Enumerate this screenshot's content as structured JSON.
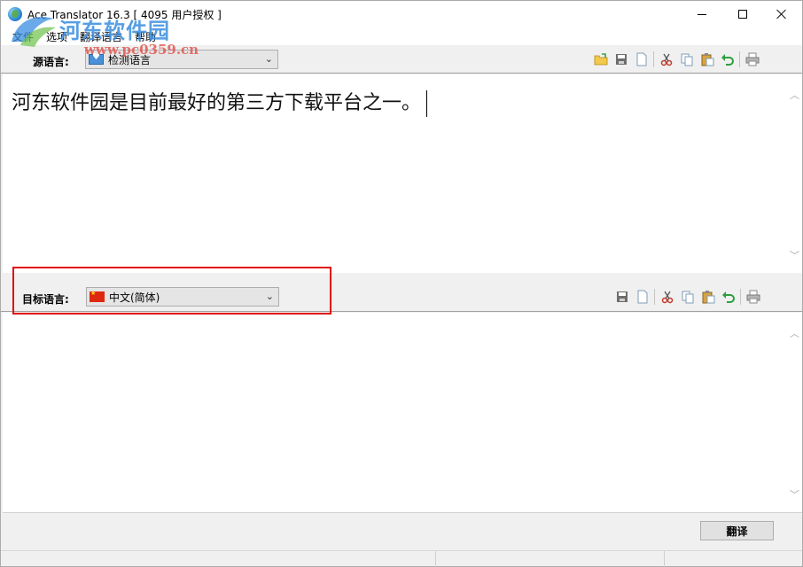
{
  "window": {
    "title": "Ace Translator 16.3 [ 4095 用户授权 ]"
  },
  "watermark": {
    "name": "河东软件园",
    "url": "www.pc0359.cn"
  },
  "menu": {
    "items": [
      {
        "label": "文件"
      },
      {
        "label": "选项"
      },
      {
        "label": "翻译语言"
      },
      {
        "label": "帮助"
      }
    ]
  },
  "source": {
    "label": "源语言:",
    "selected_language": "检测语言",
    "flag_icon": "detect-language-icon",
    "text": "河东软件园是目前最好的第三方下载平台之一。"
  },
  "target": {
    "label": "目标语言:",
    "selected_language": "中文(简体)",
    "flag_icon": "china-flag-icon",
    "text": ""
  },
  "toolbar_icons": {
    "source": [
      "open-folder-icon",
      "save-icon",
      "new-document-icon",
      "cut-icon",
      "copy-icon",
      "paste-icon",
      "undo-icon",
      "print-icon"
    ],
    "target": [
      "save-icon",
      "new-document-icon",
      "cut-icon",
      "copy-icon",
      "paste-icon",
      "undo-icon",
      "print-icon"
    ]
  },
  "actions": {
    "translate_label": "翻译"
  },
  "colors": {
    "highlight": "#e01010",
    "window_bg": "#f0f0f0"
  }
}
